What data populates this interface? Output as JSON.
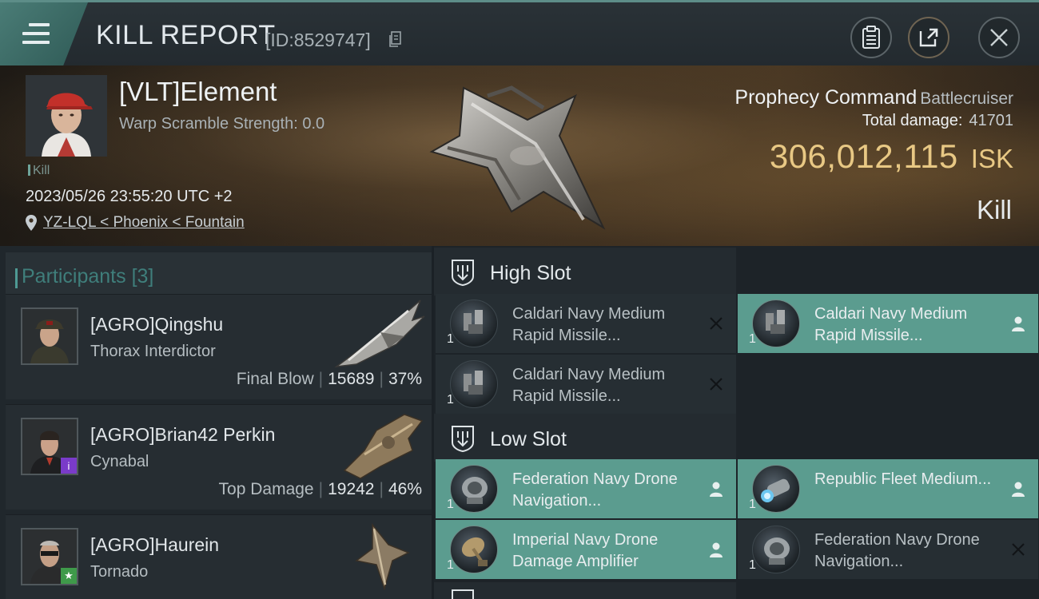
{
  "window": {
    "title": "KILL REPORT",
    "report_id": "[ID:8529747]"
  },
  "victim": {
    "name": "[VLT]Element",
    "warp_scramble": "Warp Scramble Strength: 0.0",
    "tag": "Kill",
    "timestamp": "2023/05/26 23:55:20 UTC +2",
    "location": "YZ-LQL < Phoenix < Fountain",
    "ship_name": "Prophecy Command",
    "ship_class": "Battlecruiser",
    "total_damage_label": "Total damage:",
    "total_damage": "41701",
    "isk_value": "306,012,115",
    "isk_unit": "ISK",
    "outcome": "Kill"
  },
  "participants": {
    "label": "Participants",
    "count": "[3]",
    "items": [
      {
        "name": "[AGRO]Qingshu",
        "ship": "Thorax Interdictor",
        "role": "Final Blow",
        "damage": "15689",
        "percent": "37%"
      },
      {
        "name": "[AGRO]Brian42 Perkin",
        "ship": "Cynabal",
        "role": "Top Damage",
        "damage": "19242",
        "percent": "46%"
      },
      {
        "name": "[AGRO]Haurein",
        "ship": "Tornado",
        "role": "",
        "damage": "",
        "percent": ""
      }
    ]
  },
  "fitting": {
    "high_slot": {
      "title": "High Slot",
      "modules": [
        {
          "name": "Caldari Navy Medium Rapid Missile...",
          "qty": "1",
          "status": "destroyed"
        },
        {
          "name": "Caldari Navy Medium Rapid Missile...",
          "qty": "1",
          "status": "dropped"
        },
        {
          "name": "Caldari Navy Medium Rapid Missile...",
          "qty": "1",
          "status": "destroyed"
        }
      ]
    },
    "low_slot": {
      "title": "Low Slot",
      "modules": [
        {
          "name": "Federation Navy Drone Navigation...",
          "qty": "1",
          "status": "dropped"
        },
        {
          "name": "Republic Fleet Medium...",
          "qty": "1",
          "status": "dropped"
        },
        {
          "name": "Imperial Navy Drone Damage Amplifier",
          "qty": "1",
          "status": "dropped"
        },
        {
          "name": "Federation Navy Drone Navigation...",
          "qty": "1",
          "status": "destroyed"
        }
      ]
    }
  },
  "colors": {
    "accent_teal": "#5b9c8f",
    "isk_gold": "#e8c884",
    "panel": "#262e33"
  },
  "icons": {
    "menu": "hamburger-menu-icon",
    "copy": "copy-icon",
    "clipboard": "clipboard-icon",
    "share": "share-external-icon",
    "close": "close-icon",
    "location": "map-pin-icon",
    "slot": "slot-shield-icon",
    "dropped": "person-icon",
    "destroyed": "x-mark-icon"
  }
}
